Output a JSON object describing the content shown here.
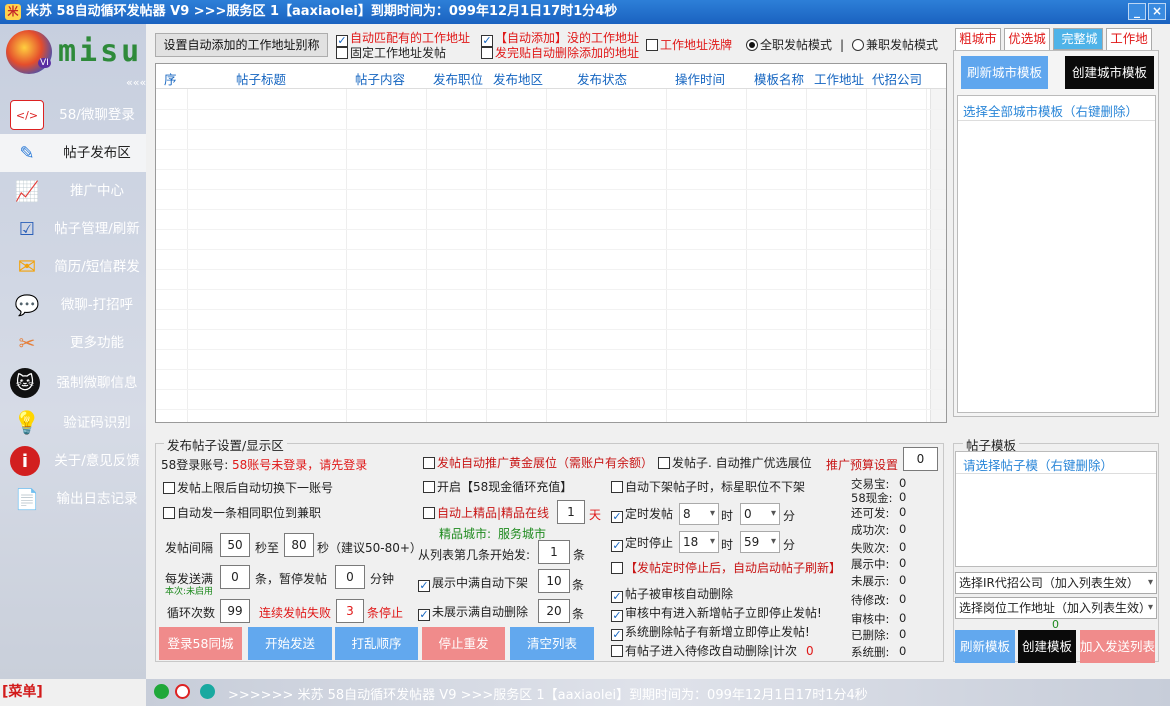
{
  "window": {
    "title": "米苏 58自动循环发帖器 V9 >>>服务区 1【aaxiaolei】到期时间为：099年12月1日17时1分4秒",
    "min": "_",
    "close": "×"
  },
  "sidebar": {
    "logo_text": "misu",
    "logo_badge": "VI",
    "collapse": "«««",
    "items": [
      {
        "label": "58/微聊登录",
        "icon": "code-window-icon"
      },
      {
        "label": "帖子发布区",
        "icon": "paint-brush-icon"
      },
      {
        "label": "推广中心",
        "icon": "bar-chart-icon"
      },
      {
        "label": "帖子管理/刷新",
        "icon": "checklist-icon"
      },
      {
        "label": "简历/短信群发",
        "icon": "envelope-icon"
      },
      {
        "label": "微聊-打招呼",
        "icon": "chat-bubbles-icon"
      },
      {
        "label": "更多功能",
        "icon": "tools-icon"
      },
      {
        "label": "强制微聊信息",
        "icon": "github-cat-icon"
      },
      {
        "label": "验证码识别",
        "icon": "lightbulb-icon"
      },
      {
        "label": "关于/意见反馈",
        "icon": "info-icon"
      },
      {
        "label": "输出日志记录",
        "icon": "document-icon"
      }
    ],
    "menu": "[菜单]"
  },
  "toolbar": {
    "set_alias_btn": "设置自动添加的工作地址别称",
    "cb_auto_match": "自动匹配有的工作地址",
    "cb_fixed_addr": "固定工作地址发帖",
    "cb_auto_add": "【自动添加】没的工作地址",
    "cb_auto_delete": "发完贴自动删除添加的地址",
    "cb_wash": "工作地址洗牌",
    "radio_full": "全职发帖模式",
    "sep": "|",
    "radio_part": "兼职发帖模式"
  },
  "grid": {
    "columns": [
      "序",
      "帖子标题",
      "帖子内容",
      "发布职位",
      "发布地区",
      "发布状态",
      "操作时间",
      "模板名称",
      "工作地址",
      "代招公司"
    ]
  },
  "city_tabs": [
    "粗城市",
    "优选城",
    "完整城",
    "工作地"
  ],
  "city_panel": {
    "refresh_btn": "刷新城市模板",
    "create_btn": "创建城市模板",
    "select_all": "选择全部城市模板（右键删除）"
  },
  "post_settings": {
    "legend": "发布帖子设置/显示区",
    "account_label": "58登录账号:",
    "account_status": "58账号未登录，请先登录",
    "cb_switch": "发帖上限后自动切换下一账号",
    "cb_same_job": "自动发一条相同职位到兼职",
    "interval_label": "发帖间隔",
    "interval_from": "50",
    "interval_to_label": "秒至",
    "interval_to": "80",
    "interval_hint": "秒（建议50-80+）",
    "every_label": "每发送满",
    "every_val": "0",
    "pause_label": "条，暂停发帖",
    "pause_val": "0",
    "minute_label": "分钟",
    "this_time": "本次:未启用",
    "loop_label": "循环次数",
    "loop_val": "99",
    "fail_label": "连续发帖失败",
    "fail_val": "3",
    "fail_stop": "条停止",
    "cb_gold": "发帖自动推广黄金展位（需账户有余额）",
    "cb_recharge": "开启【58现金循环充值】",
    "cb_jingpin": "自动上精品|精品在线",
    "jingpin_days": "1",
    "days_unit": "天",
    "jingpin_city_label": "精品城市:",
    "jingpin_city": "服务城市",
    "start_from_label": "从列表第几条开始发:",
    "start_from": "1",
    "unit_tiao": "条",
    "cb_full_down": "展示中满自动下架",
    "full_down_val": "10",
    "cb_unshow_del": "未展示满自动删除",
    "unshow_del_val": "20",
    "cb_optimal": "发帖子. 自动推广优选展位",
    "budget_label": "推广预算设置",
    "budget_val": "0",
    "cb_auto_off": "自动下架帖子时，标星职位不下架",
    "cb_timed_post": "定时发帖",
    "timed_post_h": "8",
    "hour": "时",
    "timed_post_m": "0",
    "minute": "分",
    "cb_timed_stop": "定时停止",
    "timed_stop_h": "18",
    "timed_stop_m": "59",
    "cb_restart_refresh": "【发帖定时停止后，自动启动帖子刷新】",
    "cb_review_del": "帖子被审核自动删除",
    "cb_review_stop": "审核中有进入新增帖子立即停止发帖!",
    "cb_sys_del_stop": "系统删除帖子有新增立即停止发帖!",
    "cb_pending_del": "有帖子进入待修改自动删除|计次",
    "pending_count": "0",
    "stats": [
      {
        "label": "交易宝:",
        "value": "0"
      },
      {
        "label": "58现金:",
        "value": "0"
      },
      {
        "label": "还可发:",
        "value": "0"
      },
      {
        "label": "成功次:",
        "value": "0"
      },
      {
        "label": "失败次:",
        "value": "0"
      },
      {
        "label": "展示中:",
        "value": "0"
      },
      {
        "label": "未展示:",
        "value": "0"
      },
      {
        "label": "待修改:",
        "value": "0"
      },
      {
        "label": "审核中:",
        "value": "0"
      },
      {
        "label": "已删除:",
        "value": "0"
      },
      {
        "label": "系统删:",
        "value": "0"
      }
    ],
    "buttons": {
      "login": "登录58同城",
      "start": "开始发送",
      "shuffle": "打乱顺序",
      "stop": "停止重发",
      "clear": "清空列表"
    }
  },
  "template_panel": {
    "legend": "帖子模板",
    "select_hint": "请选择帖子模（右键删除）",
    "company_select": "选择IR代招公司（加入列表生效）",
    "address_select": "选择岗位工作地址（加入列表生效）",
    "count": "0",
    "refresh_btn": "刷新模板",
    "create_btn": "创建模板",
    "add_btn": "加入发送列表"
  },
  "statusbar": {
    "text": ">>>>>> 米苏 58自动循环发帖器 V9 >>>服务区 1【aaxiaolei】到期时间为：099年12月1日17时1分4秒"
  },
  "colors": {
    "accent_blue": "#62a8ee",
    "pink_btn": "#f08b8b",
    "black_btn": "#0a0a0a",
    "title_bar": "#1f6fce"
  }
}
